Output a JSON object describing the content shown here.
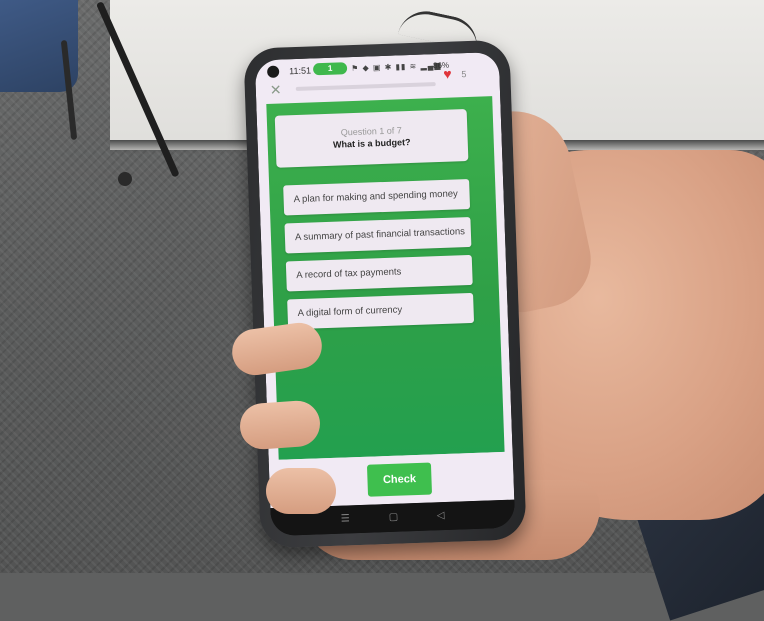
{
  "status_bar": {
    "time": "11:51",
    "notification": "1",
    "battery": "86%"
  },
  "header": {
    "lives": "5",
    "close_icon": "close-icon",
    "heart_icon": "heart-icon",
    "heart_color": "#e0353b"
  },
  "question": {
    "counter": "Question 1 of 7",
    "text": "What is a budget?"
  },
  "options": [
    "A plan for making and spending money",
    "A summary of past financial transactions",
    "A record of tax payments",
    "A digital form of currency"
  ],
  "footer": {
    "check_label": "Check",
    "accent_color": "#3fbf4e"
  },
  "nav_bar": {
    "menu_icon": "menu-icon",
    "home_icon": "home-icon",
    "back_icon": "back-icon"
  }
}
